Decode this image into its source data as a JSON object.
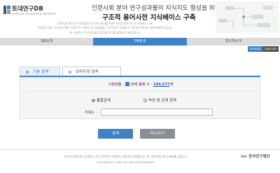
{
  "header": {
    "logo_title": "토대연구DB",
    "logo_sub": "KOREAN RESEARCH MEMORY",
    "title_line1": "인문사회 분야 연구성과물의 지식지도 형성을 위한",
    "title_line2": "구조적 용어사전 지식베이스 구축"
  },
  "intro": {
    "line1": "인문사회 분야 연구성과물의 지식지도 형성을 위한 구조적 용어사전 지식베이스 구축",
    "line2": "토대연구DB는 한국연구재단 지원으로 구축된 연구성과물을 구조적으로 검색할 수 있도록 지원하는 데이터베이스입니다",
    "line3": "본 사이트는 연구성과물의 용어와 지식을 통합하여 제공합니다"
  },
  "nav": {
    "items": [
      "DB소개",
      "DB검색",
      "연구자소개"
    ]
  },
  "lang": {
    "ko": "KOREAN",
    "en": "ENGLISH"
  },
  "tabs": {
    "basic": "기본 검색",
    "browse": "브라우징 검색"
  },
  "search": {
    "count_label": "기본현황 :",
    "total_label": "전체 용례 수 :",
    "total_value": "199,577",
    "total_unit": "개",
    "radio_general": "통합검색",
    "radio_attr": "속성 및 관계 검색",
    "keyword_label": "키워드 :",
    "keyword_value": ""
  },
  "buttons": {
    "search": "검색",
    "reset": "다시쓰기"
  },
  "footer": {
    "line1": "한국연구재단에서 운영하는 모든 사이트의 콘텐츠는 저작권의 보호를 받는 바, 무단전재, 복사, 배포를 금합니다.",
    "line2": "COPYRIGHT(C) NRF. ALL RIGHTS RESERVED.",
    "org_mark": "NRF",
    "org_name": "한국연구재단"
  },
  "colors": {
    "accent": "#3f82c6",
    "nav_bg": "#dbdbdb",
    "reset_btn": "#8a8f95"
  }
}
